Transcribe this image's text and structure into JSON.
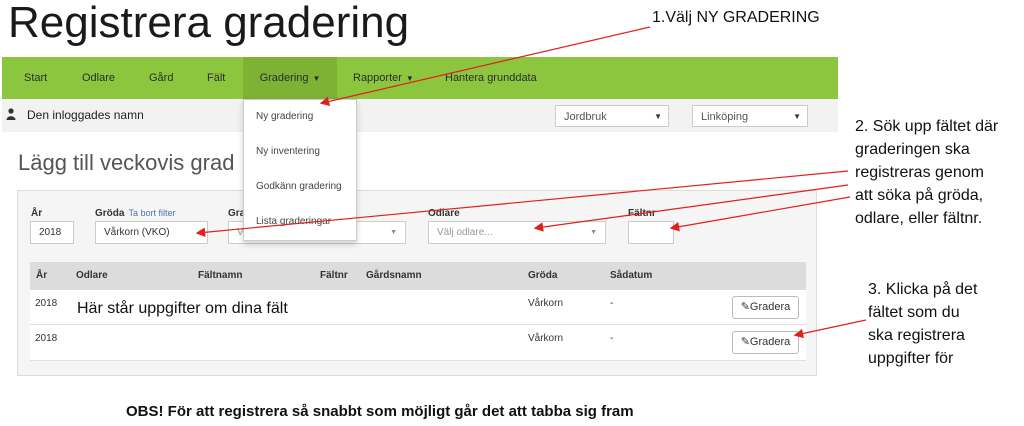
{
  "slide_title": "Registrera gradering",
  "nav": {
    "items": [
      {
        "label": "Start"
      },
      {
        "label": "Odlare"
      },
      {
        "label": "Gård"
      },
      {
        "label": "Fält"
      },
      {
        "label": "Gradering"
      },
      {
        "label": "Rapporter"
      },
      {
        "label": "Hantera grunddata"
      }
    ]
  },
  "userbar": {
    "name": "Den inloggades namn",
    "select_1": "Jordbruk",
    "select_2": "Linköping"
  },
  "page_heading": "Lägg till veckovis grad",
  "filters": {
    "year_label": "År",
    "year_value": "2018",
    "crop_label": "Gröda",
    "crop_link": "Ta bort filter",
    "crop_value": "Vårkorn (VKO)",
    "grad_label": "Gra",
    "grad_value": "V",
    "grower_label": "Odlare",
    "grower_placeholder": "Välj odlare...",
    "field_label": "Fältnr",
    "field_value": ""
  },
  "table": {
    "headers": [
      "År",
      "Odlare",
      "Fältnamn",
      "Fältnr",
      "Gårdsnamn",
      "Gröda",
      "Sådatum"
    ],
    "rows": [
      {
        "year": "2018",
        "crop": "Vårkorn",
        "sowing_date": "-",
        "action": "Gradera"
      },
      {
        "year": "2018",
        "crop": "Vårkorn",
        "sowing_date": "-",
        "action": "Gradera"
      }
    ],
    "overlay_text": "Här står uppgifter om dina fält"
  },
  "dropdown": {
    "items": [
      {
        "label": "Ny gradering"
      },
      {
        "label": "Ny inventering"
      },
      {
        "label": "Godkänn gradering"
      },
      {
        "label": "Lista graderingar"
      }
    ]
  },
  "annotations": {
    "step1": "1.Välj NY GRADERING",
    "step2_lines": [
      "2. Sök upp fältet där",
      "graderingen ska",
      "registreras genom",
      "att söka på gröda,",
      "odlare, eller fältnr."
    ],
    "step3_lines": [
      "3. Klicka på det",
      "fältet som du",
      "ska registrera",
      "uppgifter för"
    ],
    "bottom_note": "OBS! För att registrera så snabbt som möjligt går det att tabba sig fram"
  },
  "colors": {
    "nav_green": "#8cc63f",
    "nav_active": "#7db234",
    "arrow_red": "#e0201b",
    "link_blue": "#4a76b3"
  }
}
